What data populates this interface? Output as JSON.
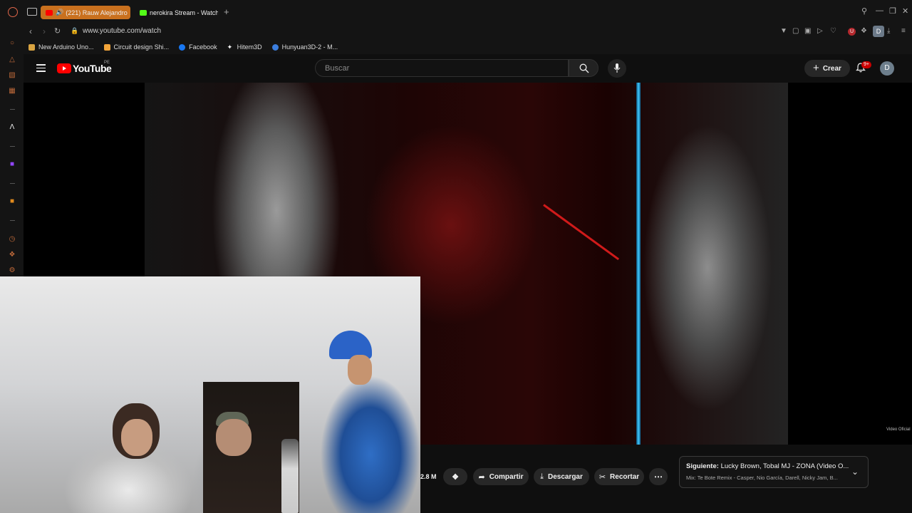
{
  "tabs": [
    {
      "label": "(221) Rauw Alejandro",
      "active": true,
      "favicon_color": "#ff0000"
    },
    {
      "label": "nerokira Stream - Watch L",
      "active": false,
      "favicon_color": "#53fc18"
    }
  ],
  "address_bar": {
    "url": "www.youtube.com/watch"
  },
  "bookmarks": [
    {
      "label": "New Arduino Uno...",
      "icon": "#d9a441"
    },
    {
      "label": "Circuit design Shi...",
      "icon": "#f2a43a"
    },
    {
      "label": "Facebook",
      "icon": "#1877f2"
    },
    {
      "label": "Hitem3D",
      "icon": "#ffffff"
    },
    {
      "label": "Hunyuan3D-2 - M...",
      "icon": "#3b7ddd"
    }
  ],
  "browser": {
    "profile_initial": "D",
    "ext_badge": "U"
  },
  "masthead": {
    "logo_text": "YouTube",
    "country_code": "PE",
    "search_placeholder": "Buscar",
    "create_label": "Crear",
    "notifications_count": "9+",
    "avatar_initial": "D"
  },
  "video": {
    "watermark": "Video Oficial"
  },
  "actions": {
    "views": "2.8 M",
    "share_label": "Compartir",
    "download_label": "Descargar",
    "clip_label": "Recortar"
  },
  "up_next": {
    "prefix": "Siguiente:",
    "title": "Lucky Brown, Tobal MJ - ZONA (Video O...",
    "subtitle": "Mix: Te Bote Remix - Casper, Nio García, Darell, Nicky Jam, B..."
  },
  "colors": {
    "accent": "#c9701e",
    "yt_red": "#ff0000",
    "background": "#0f0f0f"
  }
}
